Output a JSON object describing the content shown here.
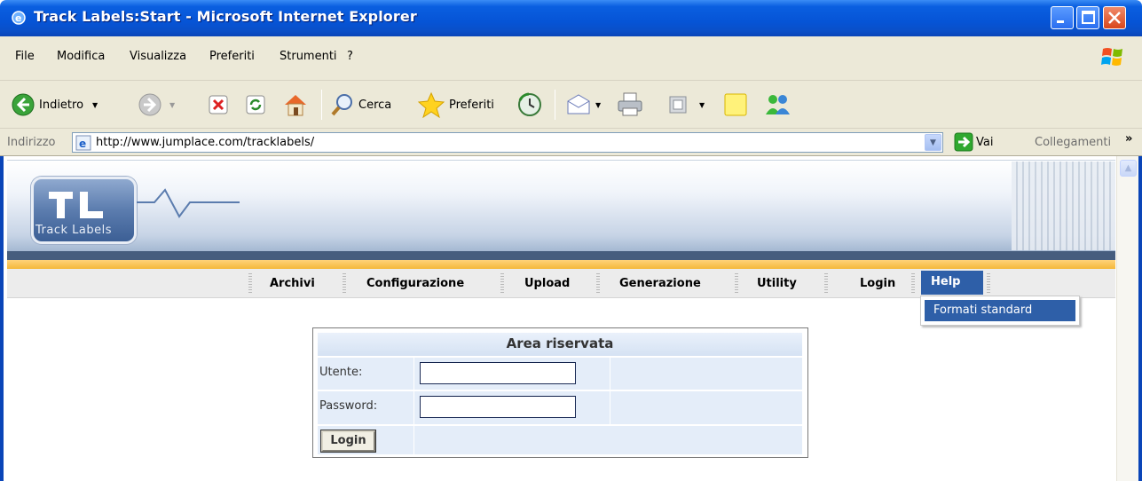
{
  "window": {
    "title": "Track Labels:Start - Microsoft Internet Explorer"
  },
  "menubar": {
    "items": [
      "File",
      "Modifica",
      "Visualizza",
      "Preferiti",
      "Strumenti",
      "?"
    ]
  },
  "toolbar": {
    "back_label": "Indietro",
    "search_label": "Cerca",
    "favorites_label": "Preferiti"
  },
  "addressbar": {
    "label": "Indirizzo",
    "url": "http://www.jumplace.com/tracklabels/",
    "go_label": "Vai",
    "links_label": "Collegamenti"
  },
  "site": {
    "logo_text": "Track Labels",
    "nav": [
      "Archivi",
      "Configurazione",
      "Upload",
      "Generazione",
      "Utility",
      "Login"
    ],
    "nav_active": "Help",
    "dropdown_item": "Formati standard"
  },
  "login": {
    "title": "Area riservata",
    "user_label": "Utente:",
    "password_label": "Password:",
    "button_label": "Login"
  }
}
